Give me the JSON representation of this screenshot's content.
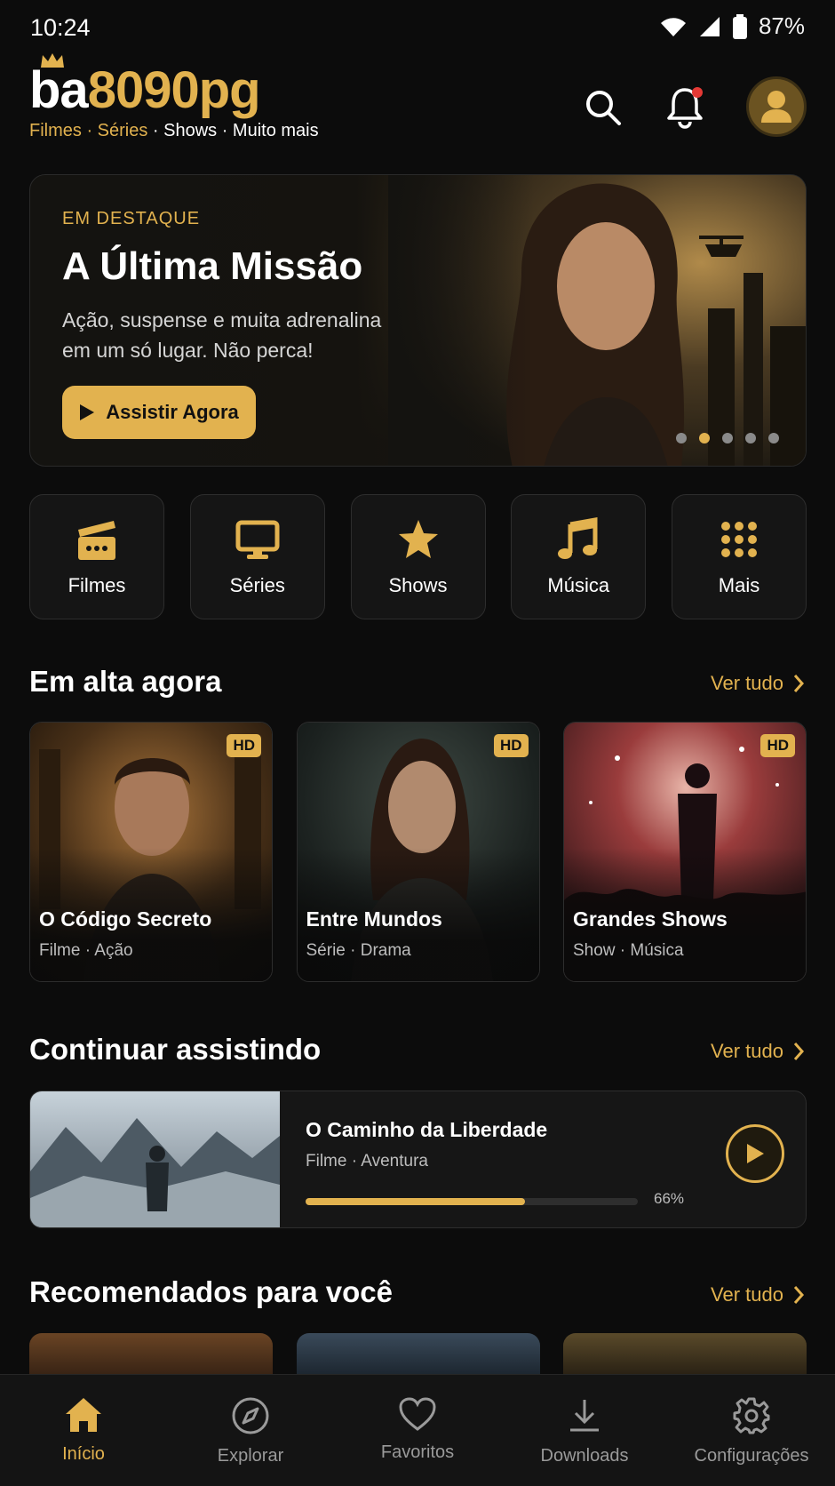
{
  "status": {
    "time": "10:24",
    "battery": "87%"
  },
  "header": {
    "logo_white": "ba",
    "logo_gold": "8090pg",
    "tagline_gold": "Filmes · Séries",
    "tagline_white": " · Shows · Muito mais"
  },
  "hero": {
    "kicker": "EM DESTAQUE",
    "title": "A Última Missão",
    "description": "Ação, suspense e muita adrenalina em um só lugar. Não perca!",
    "cta": "Assistir Agora",
    "pages": 5,
    "active_page": 1
  },
  "categories": [
    {
      "label": "Filmes",
      "icon": "clapperboard-icon"
    },
    {
      "label": "Séries",
      "icon": "tv-icon"
    },
    {
      "label": "Shows",
      "icon": "star-icon"
    },
    {
      "label": "Música",
      "icon": "music-note-icon"
    },
    {
      "label": "Mais",
      "icon": "grid-icon"
    }
  ],
  "trending": {
    "title": "Em alta agora",
    "see_all": "Ver tudo",
    "items": [
      {
        "badge": "HD",
        "title": "O Código Secreto",
        "subtitle": "Filme · Ação"
      },
      {
        "badge": "HD",
        "title": "Entre Mundos",
        "subtitle": "Série · Drama"
      },
      {
        "badge": "HD",
        "title": "Grandes Shows",
        "subtitle": "Show · Música"
      }
    ]
  },
  "continue": {
    "title": "Continuar assistindo",
    "see_all": "Ver tudo",
    "item": {
      "title": "O Caminho da Liberdade",
      "subtitle": "Filme · Aventura",
      "progress_label": "66%",
      "progress": 0.66
    }
  },
  "recommended": {
    "title": "Recomendados para você",
    "see_all": "Ver tudo"
  },
  "nav": [
    {
      "label": "Início",
      "icon": "home-icon",
      "active": true
    },
    {
      "label": "Explorar",
      "icon": "compass-icon",
      "active": false
    },
    {
      "label": "Favoritos",
      "icon": "heart-icon",
      "active": false
    },
    {
      "label": "Downloads",
      "icon": "download-icon",
      "active": false
    },
    {
      "label": "Configurações",
      "icon": "gear-icon",
      "active": false
    }
  ],
  "colors": {
    "accent": "#e2b24f",
    "background": "#0c0c0c",
    "card": "#151515"
  }
}
